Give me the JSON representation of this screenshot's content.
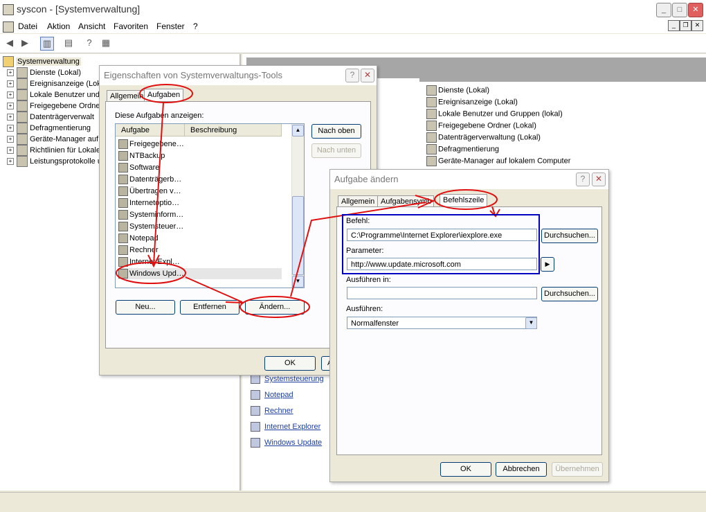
{
  "window": {
    "title": "syscon - [Systemverwaltung]"
  },
  "menu": [
    "Datei",
    "Aktion",
    "Ansicht",
    "Favoriten",
    "Fenster",
    "?"
  ],
  "tree": {
    "root": "Systemverwaltung",
    "items": [
      "Dienste (Lokal)",
      "Ereignisanzeige (Lok",
      "Lokale Benutzer und",
      "Freigegebene Ordne",
      "Datenträgerverwalt",
      "Defragmentierung",
      "Geräte-Manager auf",
      "Richtlinien für Lokale",
      "Leistungsprotokolle u"
    ]
  },
  "right_list": [
    "Dienste (Lokal)",
    "Ereignisanzeige (Lokal)",
    "Lokale Benutzer und Gruppen (lokal)",
    "Freigegebene Ordner (Lokal)",
    "Datenträgerverwaltung (Lokal)",
    "Defragmentierung",
    "Geräte-Manager auf lokalem Computer"
  ],
  "right_links": [
    "Systemsteuerung",
    "Notepad",
    "Rechner",
    "Internet Explorer",
    "Windows Update"
  ],
  "dialog1": {
    "title": "Eigenschaften von Systemverwaltungs-Tools",
    "tabs": [
      "Allgemein",
      "Aufgaben"
    ],
    "label": "Diese Aufgaben anzeigen:",
    "columns": [
      "Aufgabe",
      "Beschreibung"
    ],
    "items": [
      "Freigegebene…",
      "NTBackup",
      "Software",
      "Datenträgerb…",
      "Übertragen v…",
      "Internetoptio…",
      "Systeminform…",
      "Systemsteuer…",
      "Notepad",
      "Rechner",
      "Internet Expl…",
      "Windows Upd…"
    ],
    "btn_up": "Nach oben",
    "btn_down": "Nach unten",
    "btn_new": "Neu...",
    "btn_remove": "Entfernen",
    "btn_edit": "Ändern...",
    "btn_ok": "OK",
    "btn_cancel_partial": "A"
  },
  "dialog2": {
    "title": "Aufgabe ändern",
    "tabs": [
      "Allgemein",
      "Aufgabensymb",
      "Befehlszeile"
    ],
    "befehl_label": "Befehl:",
    "befehl_value": "C:\\Programme\\Internet Explorer\\iexplore.exe",
    "browse": "Durchsuchen...",
    "param_label": "Parameter:",
    "param_value": "http://www.update.microsoft.com",
    "run_in_label": "Ausführen in:",
    "run_in_value": "",
    "browse2": "Durchsuchen...",
    "run_label": "Ausführen:",
    "run_value": "Normalfenster",
    "ok": "OK",
    "cancel": "Abbrechen",
    "apply": "Übernehmen"
  },
  "colors": {
    "annotation_red": "#e01010",
    "annotation_blue": "#0000c0",
    "link": "#1f3fa0"
  }
}
